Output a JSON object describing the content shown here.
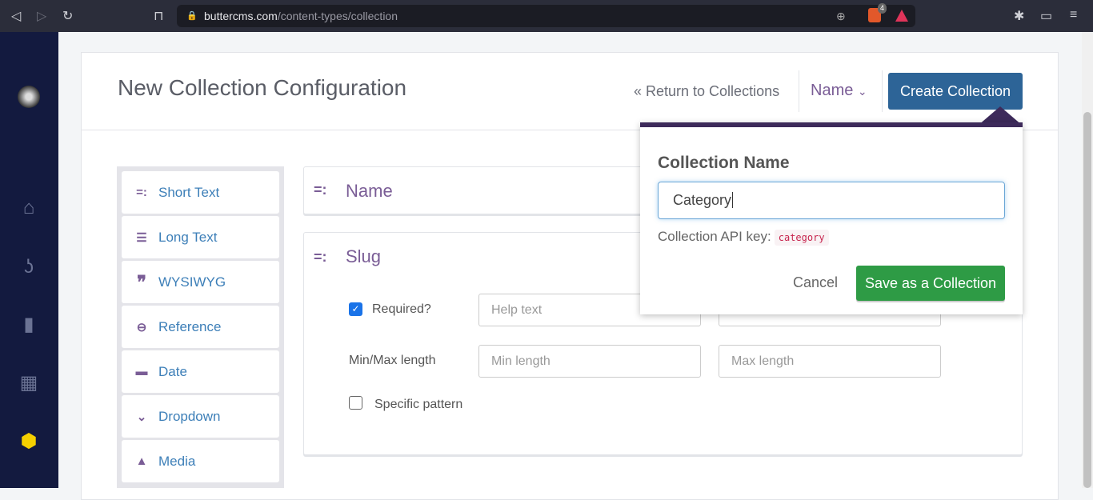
{
  "browser": {
    "url_domain": "buttercms.com",
    "url_path": "/content-types/collection",
    "shield_count": "4"
  },
  "header": {
    "title": "New Collection Configuration",
    "return_link": "« Return to Collections",
    "name_dropdown": "Name",
    "create_button": "Create Collection"
  },
  "palette": {
    "items": [
      {
        "label": "Short Text",
        "icon": "short-text-icon"
      },
      {
        "label": "Long Text",
        "icon": "long-text-icon"
      },
      {
        "label": "WYSIWYG",
        "icon": "quote-icon"
      },
      {
        "label": "Reference",
        "icon": "link-icon"
      },
      {
        "label": "Date",
        "icon": "calendar-icon"
      },
      {
        "label": "Dropdown",
        "icon": "chevron-down-icon"
      },
      {
        "label": "Media",
        "icon": "image-icon"
      }
    ]
  },
  "fields": {
    "name": {
      "title": "Name"
    },
    "slug": {
      "title": "Slug",
      "required_label": "Required?",
      "required_checked": true,
      "help_placeholder": "Help text",
      "minmax_label": "Min/Max length",
      "min_placeholder": "Min length",
      "max_placeholder": "Max length",
      "pattern_label": "Specific pattern",
      "pattern_checked": false
    }
  },
  "popover": {
    "heading": "Collection Name",
    "input_value": "Category",
    "api_key_label": "Collection API key:",
    "api_key": "category",
    "cancel": "Cancel",
    "save": "Save as a Collection"
  },
  "colors": {
    "accent": "#7a5d96",
    "primary": "#2d6497",
    "success": "#2e9b45",
    "sidebar": "#131a3f"
  }
}
